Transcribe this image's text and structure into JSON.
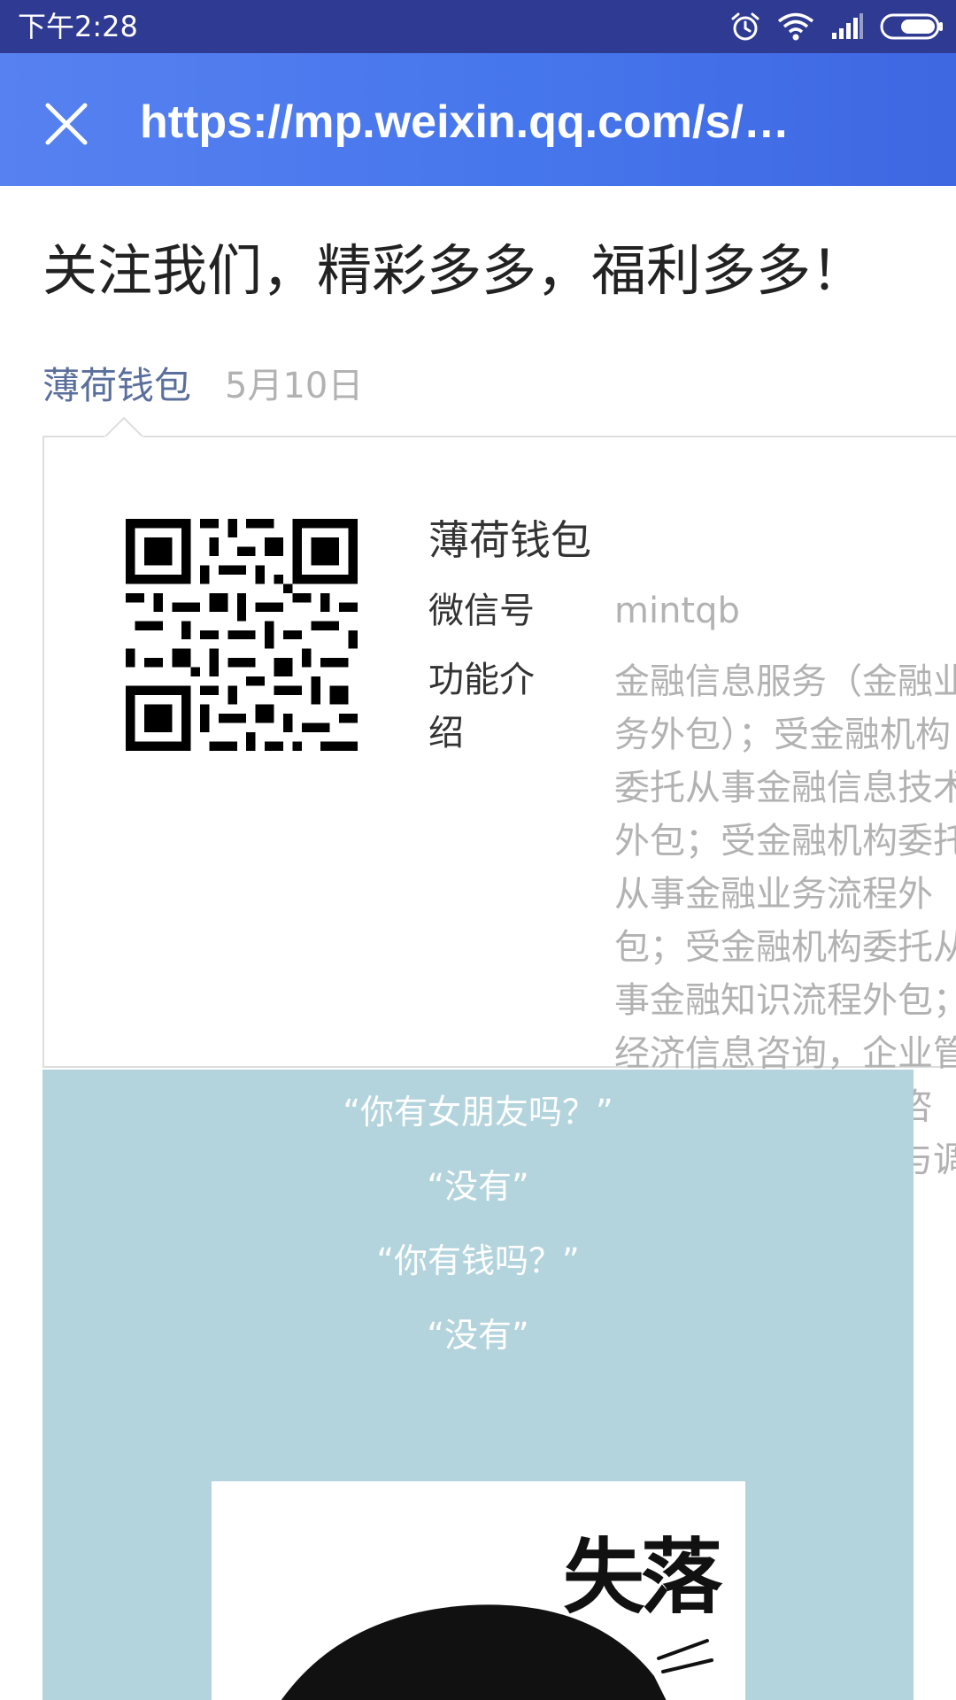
{
  "status_bar": {
    "time": "下午2:28",
    "icons": [
      "alarm-icon",
      "wifi-icon",
      "signal-icon",
      "battery-icon"
    ]
  },
  "header": {
    "url": "https://mp.weixin.qq.com/s/K…",
    "close_icon": "close-icon"
  },
  "article": {
    "title": "关注我们，精彩多多，福利多多！",
    "account": "薄荷钱包",
    "date": "5月10日"
  },
  "profile_card": {
    "name": "薄荷钱包",
    "wechat_id_label": "微信号",
    "wechat_id": "mintqb",
    "intro_label": "功能介绍",
    "intro": "金融信息服务（金融业务外包）；受金融机构委托从事金融信息技术外包；受金融机构委托从事金融业务流程外包；受金融机构委托从事金融知识流程外包；经济信息咨询，企业管理咨询，财务信息咨询，商务信息咨询与调查。"
  },
  "content": {
    "lines": [
      "“你有女朋友吗？”",
      "“没有”",
      "“你有钱吗？”",
      "“没有”"
    ],
    "image_caption": "失落"
  },
  "colors": {
    "status_bar": "#2f3a92",
    "header_start": "#5781f0",
    "header_end": "#3e67e2",
    "account_link": "#5a6f9c",
    "content_bg": "#b3d4dc"
  }
}
